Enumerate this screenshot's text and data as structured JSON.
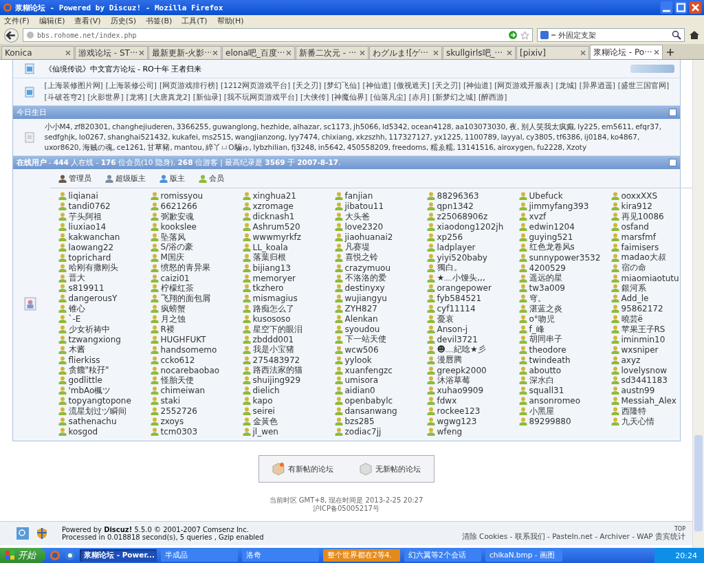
{
  "window": {
    "title": "浆糊论坛 - Powered by Discuz! - Mozilla Firefox"
  },
  "menu": [
    "文件(F)",
    "编辑(E)",
    "查看(V)",
    "历史(S)",
    "书签(B)",
    "工具(T)",
    "帮助(H)"
  ],
  "address": {
    "value": "bbs.rohome.net/index.php"
  },
  "search": {
    "value": "外固定支架"
  },
  "tabs": [
    {
      "label": "Konica",
      "selected": false
    },
    {
      "label": "游戏论坛 - ST···",
      "selected": false
    },
    {
      "label": "最新更新-火影···",
      "selected": false
    },
    {
      "label": "elona吧_百度···",
      "selected": false
    },
    {
      "label": "新番二次元 - ···",
      "selected": false
    },
    {
      "label": "わグルま![ゲ···",
      "selected": false
    },
    {
      "label": "skullgirls吧_···",
      "selected": false
    },
    {
      "label": "[pixiv]",
      "selected": false
    },
    {
      "label": "浆糊论坛 - Po···",
      "selected": true
    }
  ],
  "partner": {
    "title": "《仙境传说》中文官方论坛 - RO十年 王者归来",
    "links": [
      "[上海装修图片网]",
      "[上海装修公司]",
      "[网页游戏排行榜]",
      "[1212网页游戏平台]",
      "[天之刃]",
      "[梦幻飞仙]",
      "[神仙道]",
      "[傲视遮天]",
      "[天之刃]",
      "[神仙道]",
      "[网页游戏开服表]",
      "[龙城]",
      "[异界逍遥]",
      "[盛世三国官网]",
      "[斗破苍穹2]",
      "[火影世界]",
      "[龙将]",
      "[大唐真龙2]",
      "[新仙录]",
      "[我不玩网页游戏平台]",
      "[大侠传]",
      "[神魔仙界]",
      "[仙落凡尘]",
      "[赤月]",
      "[新梦幻之城]",
      "[醉西游]"
    ]
  },
  "birthdays": {
    "title": "今日生日",
    "text": "小小M4, zf820301, changhejiuderen, 3366255, guwanglong, hezhide, alhazar, sc1173, jh5066, ld5342, ocean4128, aa103073030, 夜, 别人笑我太疯癫, ly225, em5611, efqr37, sedfghjk, lo0267, shanghai521432, kukafei, ms2515, wangjianzong, lyy7474, chixiang, xkzszhh, 117327127, yx1225, 1100789, layyal, cy3805, tf6386, ij0184, ko4867, uxor8620, 海贼の魂, ce1261, 甘草豬, mantou, 綷丫ㄩO騙ゅ, lybzhilian, fj3248, in5642, 450558209, freedoms, 糯ゑ糯, 13141516, airoxygen, fu2228, Xzoty"
  },
  "online": {
    "title": "**在线用户** - **444** 人在线 - **176** 位会员(10 隐身), **268** 位游客 | 最高纪录是 **3569** 于 **2007-8-17**.",
    "legend": [
      {
        "label": "管理员",
        "color": "#6b5a4a"
      },
      {
        "label": "超级版主",
        "color": "#7d8ea0"
      },
      {
        "label": "版主",
        "color": "#4f8fd6"
      },
      {
        "label": "会员",
        "color": "#8dbb3a"
      }
    ],
    "members": [
      [
        "liqianai",
        "tandi0762",
        "芋头阿祖",
        "liuxiao14",
        "kakwanchan",
        "laowang22",
        "toprichard",
        "哈刚有撒刚头",
        "晋大",
        "s819911",
        "dangerousY",
        "锥心",
        "`-E",
        "少女祈祷中",
        "tzwangxiong",
        "木酱",
        "flierkiss",
        "贪饞\"籹孖\"",
        "godlittle",
        "'mbAo楓ツ",
        "topyangtopone",
        "流星划过ヅ瞬间",
        "sathenachu",
        "kosgod"
      ],
      [
        "romissyou",
        "6621266",
        "弼歉安魂",
        "kookslee",
        "坠落风",
        "S/浴の豪",
        "M国庆",
        "愤怒的青异果",
        "caizi01",
        "柠檬红茶",
        "飞翔的面包屑",
        "疯螃蟹",
        "月之蚀",
        "R褛",
        "HUGHFUKT",
        "handsomemo",
        "ccko612",
        "nocarebaobao",
        "怪胎天使",
        "chimeiwan",
        "staki",
        "2552726",
        "zxoys",
        "tcm0303"
      ],
      [
        "xinghua21",
        "xzromage",
        "dicknash1",
        "Ashrum520",
        "wwwmyrkfz",
        "LL_koala",
        "落葉归根",
        "bijiang13",
        "memoryer",
        "tkzhero",
        "mismagius",
        "路痴怎么了",
        "kusososo",
        "星空下的眼泪",
        "zbddd001",
        "我是小宝猪",
        "275483972",
        "路西法家的猫",
        "shuijing929",
        "dielich",
        "kapo",
        "seirei",
        "金黃色",
        "jl_wen"
      ],
      [
        "fanjian",
        "jibatou11",
        "大头爸",
        "love2320",
        "jiaohuanai2",
        "凡赛堤",
        "喜悦之铃",
        "crazymuou",
        "不洛洛的爱",
        "destinyxy",
        "wujiangyu",
        "ZYH827",
        "Alenkan",
        "syoudou",
        "下一站天使",
        "wcw506",
        "yylook",
        "xuanfengzc",
        "umisora",
        "aidian0",
        "openbabylc",
        "dansanwang",
        "bzs285",
        "zodiac7jj"
      ],
      [
        "88296363",
        "qpn1342",
        "z25068906z",
        "xiaodong1202jh",
        "xp256",
        "ladplayer",
        "yiyi520baby",
        "獨白。",
        "★﹏小馒头,,,",
        "orangepower",
        "fyb584521",
        "cyf11114",
        "憂哀",
        "Anson-j",
        "devil3721",
        "☻﹏紀唸★彡",
        "漫唇腾",
        "greepk2000",
        "沐浴草莓",
        "xuhao9909",
        "fdwx",
        "rockee123",
        "wgwg123",
        "wfeng"
      ],
      [
        "Ubefuck",
        "jimmyfang393",
        "xvzf",
        "edwin1204",
        "guying521",
        "红色龙卷风s",
        "sunnypower3532",
        "4200529",
        "遥远的星",
        "tw3a009",
        "穹。",
        "湛蓝之炎",
        "o°吻児",
        "f_峰",
        "胡同串子",
        "theodore",
        "twindeath",
        "aboutto",
        "深水白",
        "squall31",
        "ansonromeo",
        "小黑屋",
        "89299880"
      ],
      [
        "ooxxXXS",
        "kira912",
        "再见10086",
        "osfand",
        "marsfmf",
        "faimisers",
        "madao大叔",
        "宿の命",
        "miaomiaotutu",
        "銀河系",
        "Add_le",
        "95862172",
        "曉芸ё",
        "苹果王子RS",
        "iminmin10",
        "wxsniper",
        "axyz",
        "lovelysnow",
        "sd3441183",
        "austn99",
        "Messiah_Alex",
        "西隆特",
        "九天心情"
      ]
    ]
  },
  "forum_legend": [
    "有新帖的论坛",
    "无新帖的论坛"
  ],
  "time_info": [
    "当前时区 GMT+8, 现在时间是 2013-2-25 20:27",
    "沪ICP备05005217号"
  ],
  "footer": {
    "powered": "Powered by **Discuz!** 5.5.0 © 2001-2007 Comsenz Inc.",
    "processed": "Processed in 0.018818 second(s), 5 queries , Gzip enabled",
    "top": "TOP",
    "links": "清除 Cookies - 联系我们 - PasteIn.net - Archiver - WAP 贵宾统计"
  },
  "taskbar": {
    "start": "开始",
    "tasks": [
      {
        "label": "浆糊论坛 - Power...",
        "selected": true,
        "flashing": false
      },
      {
        "label": "半成品",
        "selected": false,
        "flashing": false
      },
      {
        "label": "洛奇",
        "selected": false,
        "flashing": false
      },
      {
        "label": "整个世界都在2等4.",
        "selected": false,
        "flashing": true
      },
      {
        "label": "幻六翼等2个会话",
        "selected": false,
        "flashing": false
      },
      {
        "label": "chikaN.bmp - 画图",
        "selected": false,
        "flashing": false
      }
    ],
    "clock": "20:24"
  }
}
